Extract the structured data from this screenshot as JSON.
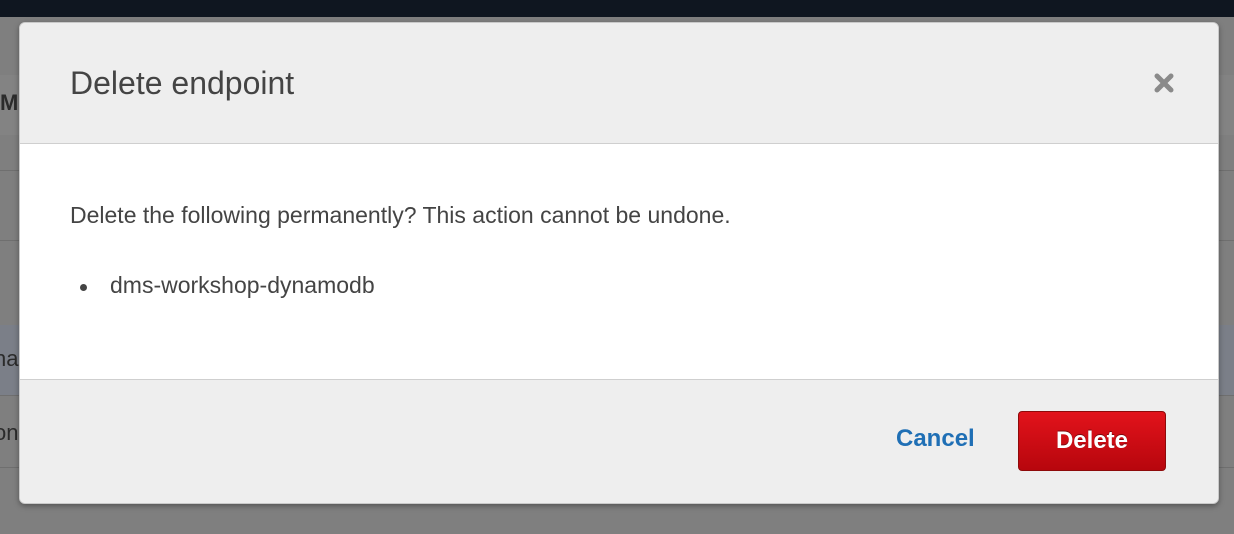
{
  "dialog": {
    "title": "Delete endpoint",
    "message": "Delete the following permanently? This action cannot be undone.",
    "items": [
      "dms-workshop-dynamodb"
    ],
    "cancel_label": "Cancel",
    "delete_label": "Delete",
    "close_icon": "close-icon"
  },
  "background": {
    "partial_texts": [
      "M",
      "na",
      "on"
    ]
  },
  "colors": {
    "delete_button": "#d10d15",
    "cancel_link": "#1f6fb5",
    "overlay": "#7f7f7f"
  }
}
